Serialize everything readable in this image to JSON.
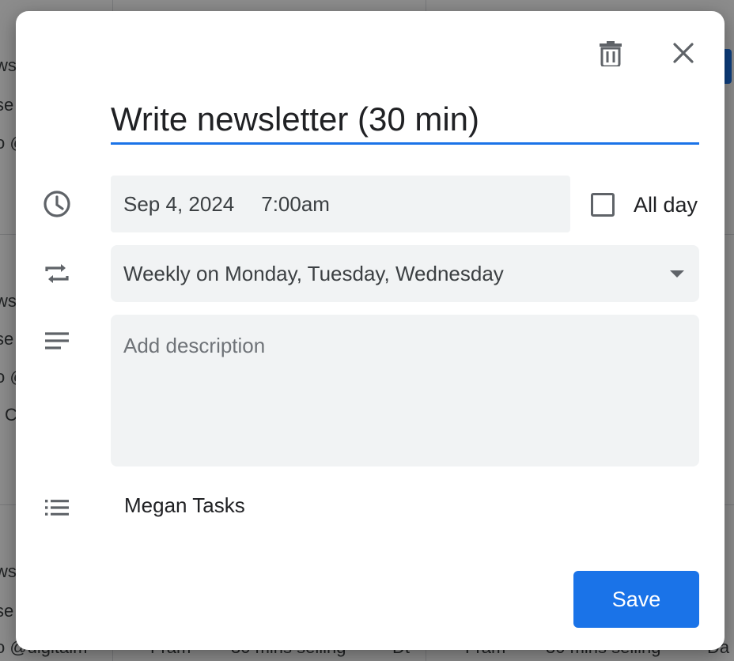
{
  "background": {
    "fragments": [
      "ws",
      "se",
      "o @",
      "ws",
      "se",
      "o @",
      "C",
      "ws",
      "se",
      "o @digitalm"
    ],
    "bottom_row": [
      "Fram",
      "30 mins selling",
      "Dt",
      "Fram",
      "30 mins selling",
      "Da"
    ]
  },
  "dialog": {
    "title": "Write newsletter (30 min)",
    "date": "Sep 4, 2024",
    "time": "7:00am",
    "all_day_label": "All day",
    "all_day_checked": false,
    "repeat": "Weekly on Monday, Tuesday, Wednesday",
    "description_placeholder": "Add description",
    "description_value": "",
    "task_list": "Megan Tasks",
    "save_label": "Save"
  },
  "icons": {
    "delete": "trash-icon",
    "close": "close-icon",
    "time": "clock-icon",
    "repeat": "repeat-icon",
    "description": "description-icon",
    "list": "list-icon"
  },
  "colors": {
    "accent": "#1a73e8",
    "field_bg": "#f1f3f4",
    "icon": "#5f6368",
    "text": "#202124"
  }
}
